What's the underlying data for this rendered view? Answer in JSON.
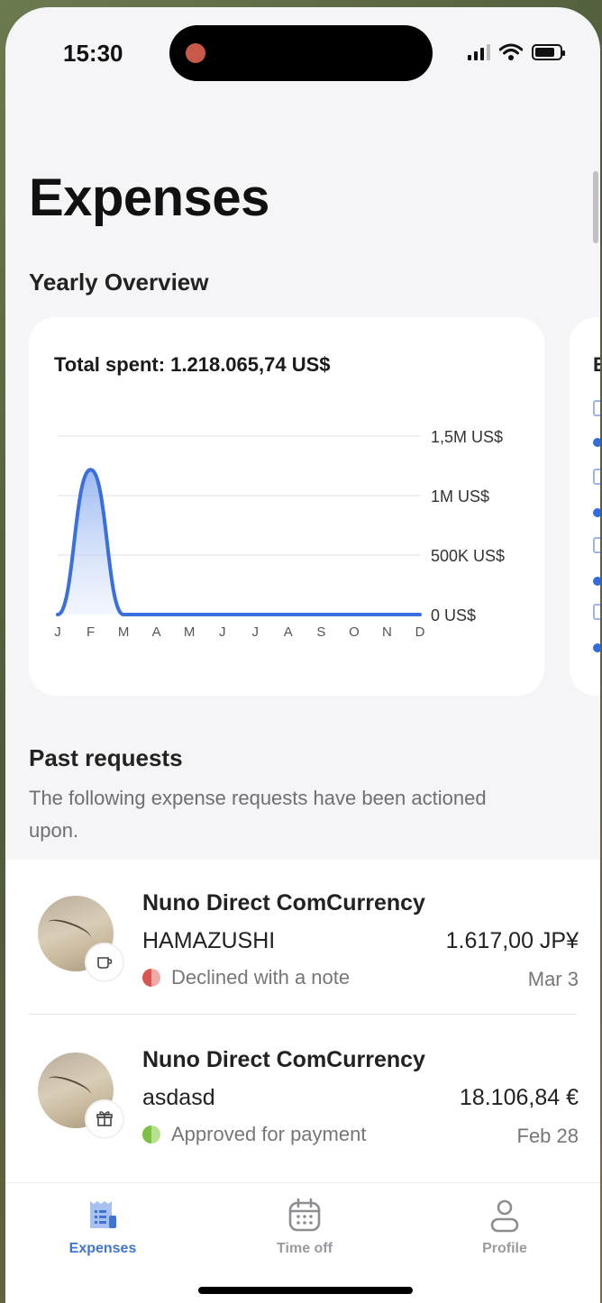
{
  "status_bar": {
    "time": "15:30"
  },
  "header": {
    "title": "Expenses"
  },
  "overview": {
    "title": "Yearly Overview",
    "total_label": "Total spent: 1.218.065,74 US$",
    "peek_letter": "E"
  },
  "chart_data": {
    "type": "area",
    "x": [
      "J",
      "F",
      "M",
      "A",
      "M",
      "J",
      "J",
      "A",
      "S",
      "O",
      "N",
      "D"
    ],
    "values": [
      0,
      1218065.74,
      0,
      0,
      0,
      0,
      0,
      0,
      0,
      0,
      0,
      0
    ],
    "y_ticks": [
      0,
      500000,
      1000000,
      1500000
    ],
    "y_tick_labels": [
      "0 US$",
      "500K US$",
      "1M US$",
      "1,5M US$"
    ],
    "ylim": [
      0,
      1500000
    ],
    "grid": true,
    "color": "#3a6fe0"
  },
  "past": {
    "title": "Past requests",
    "subtitle": "The following expense requests have been actioned upon."
  },
  "requests": [
    {
      "merchant": "Nuno Direct ComCurrency",
      "description": "HAMAZUSHI",
      "amount": "1.617,00 JP¥",
      "status": "Declined with a note",
      "status_color": "#d9534f",
      "date": "Mar 3",
      "category_icon": "coffee-cup-icon"
    },
    {
      "merchant": "Nuno Direct ComCurrency",
      "description": "asdasd",
      "amount": "18.106,84 €",
      "status": "Approved for payment",
      "status_color": "#7cc142",
      "date": "Feb 28",
      "category_icon": "gift-icon"
    }
  ],
  "tabs": [
    {
      "label": "Expenses",
      "icon": "receipt-icon",
      "active": true
    },
    {
      "label": "Time off",
      "icon": "calendar-icon",
      "active": false
    },
    {
      "label": "Profile",
      "icon": "person-icon",
      "active": false
    }
  ]
}
